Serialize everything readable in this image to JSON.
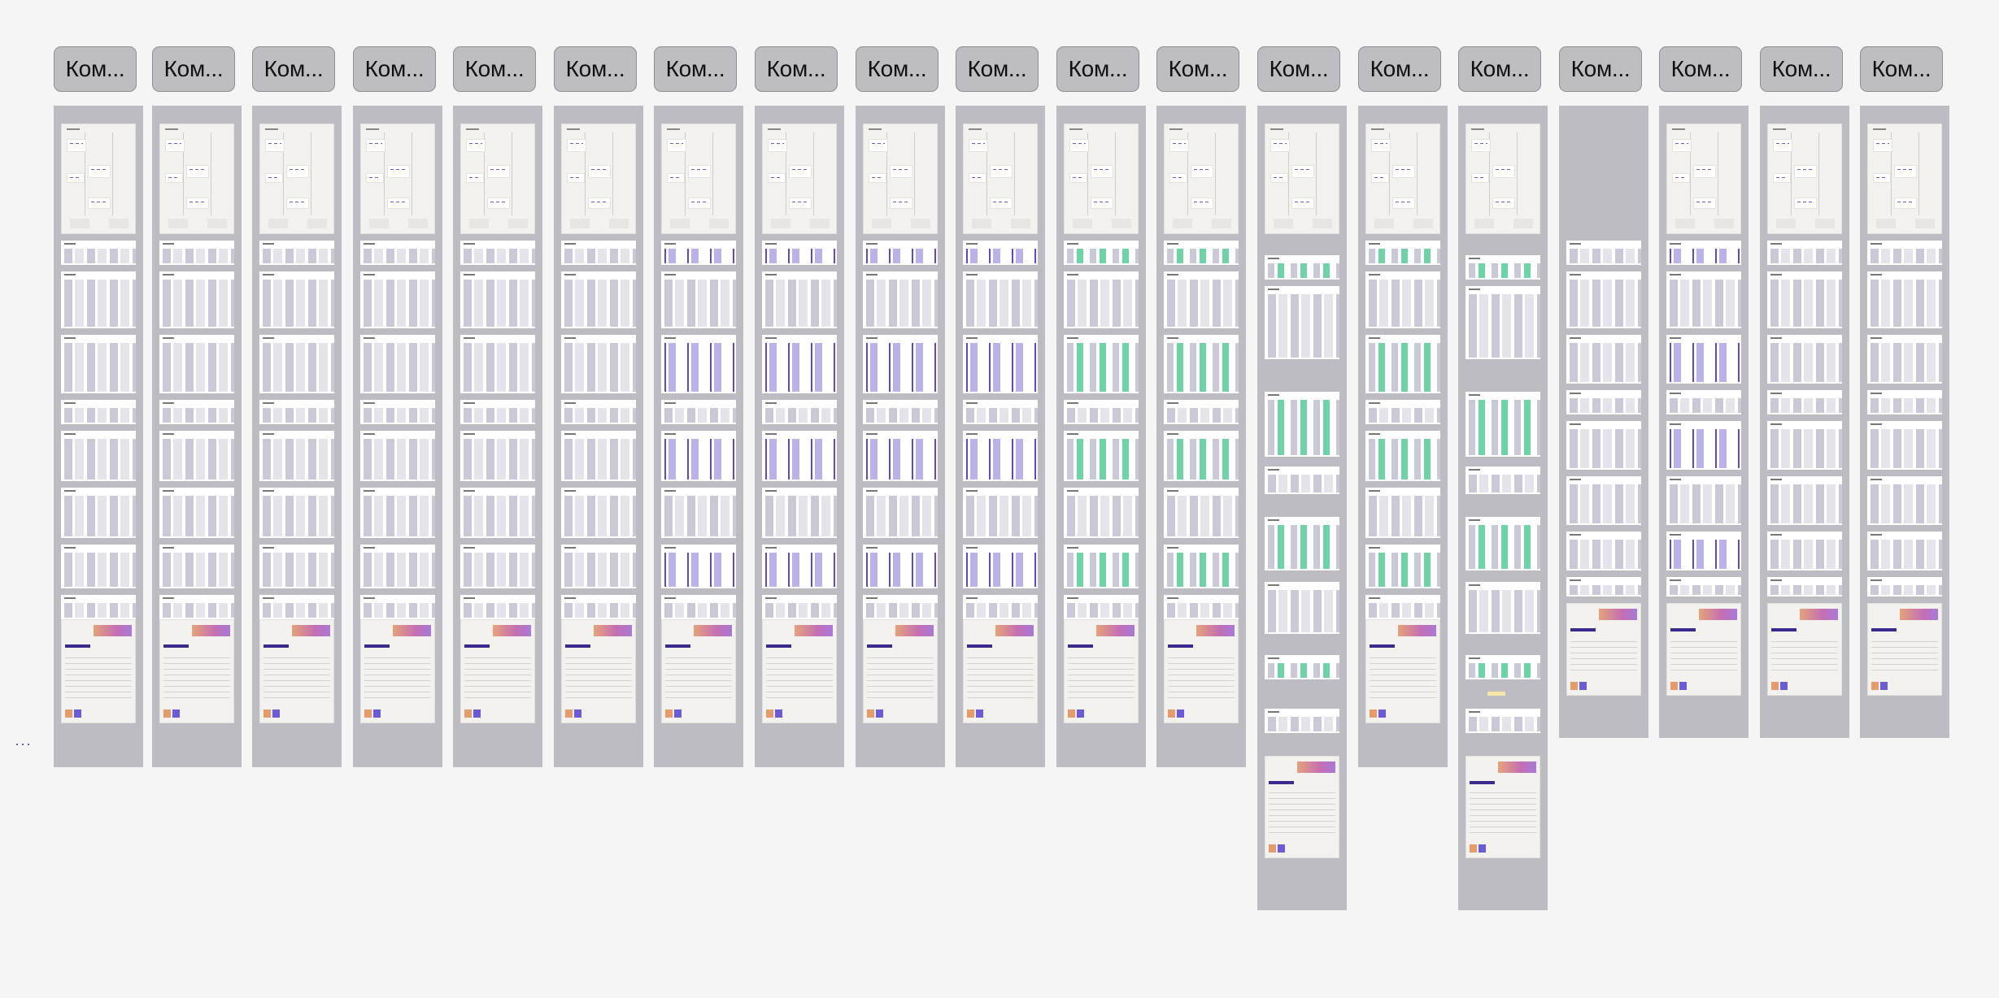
{
  "columns": [
    {
      "label": "Ком..."
    },
    {
      "label": "Ком..."
    },
    {
      "label": "Ком..."
    },
    {
      "label": "Ком..."
    },
    {
      "label": "Ком..."
    },
    {
      "label": "Ком..."
    },
    {
      "label": "Ком..."
    },
    {
      "label": "Ком..."
    },
    {
      "label": "Ком..."
    },
    {
      "label": "Ком..."
    },
    {
      "label": "Ком..."
    },
    {
      "label": "Ком..."
    },
    {
      "label": "Ком..."
    },
    {
      "label": "Ком..."
    },
    {
      "label": "Ком..."
    },
    {
      "label": "Ком..."
    },
    {
      "label": "Ком..."
    },
    {
      "label": "Ком..."
    },
    {
      "label": "Ком..."
    }
  ],
  "overflow_menu": {
    "label": "···"
  },
  "colors": {
    "canvas": "#f5f5f5",
    "column": "#bcbcc2",
    "label_fill": "#bdbdc2",
    "accent_purple": "#5a4bd0",
    "accent_green": "#6fd3a8",
    "banner_orange": "#e6a37a",
    "banner_pink": "#c46fb3"
  }
}
